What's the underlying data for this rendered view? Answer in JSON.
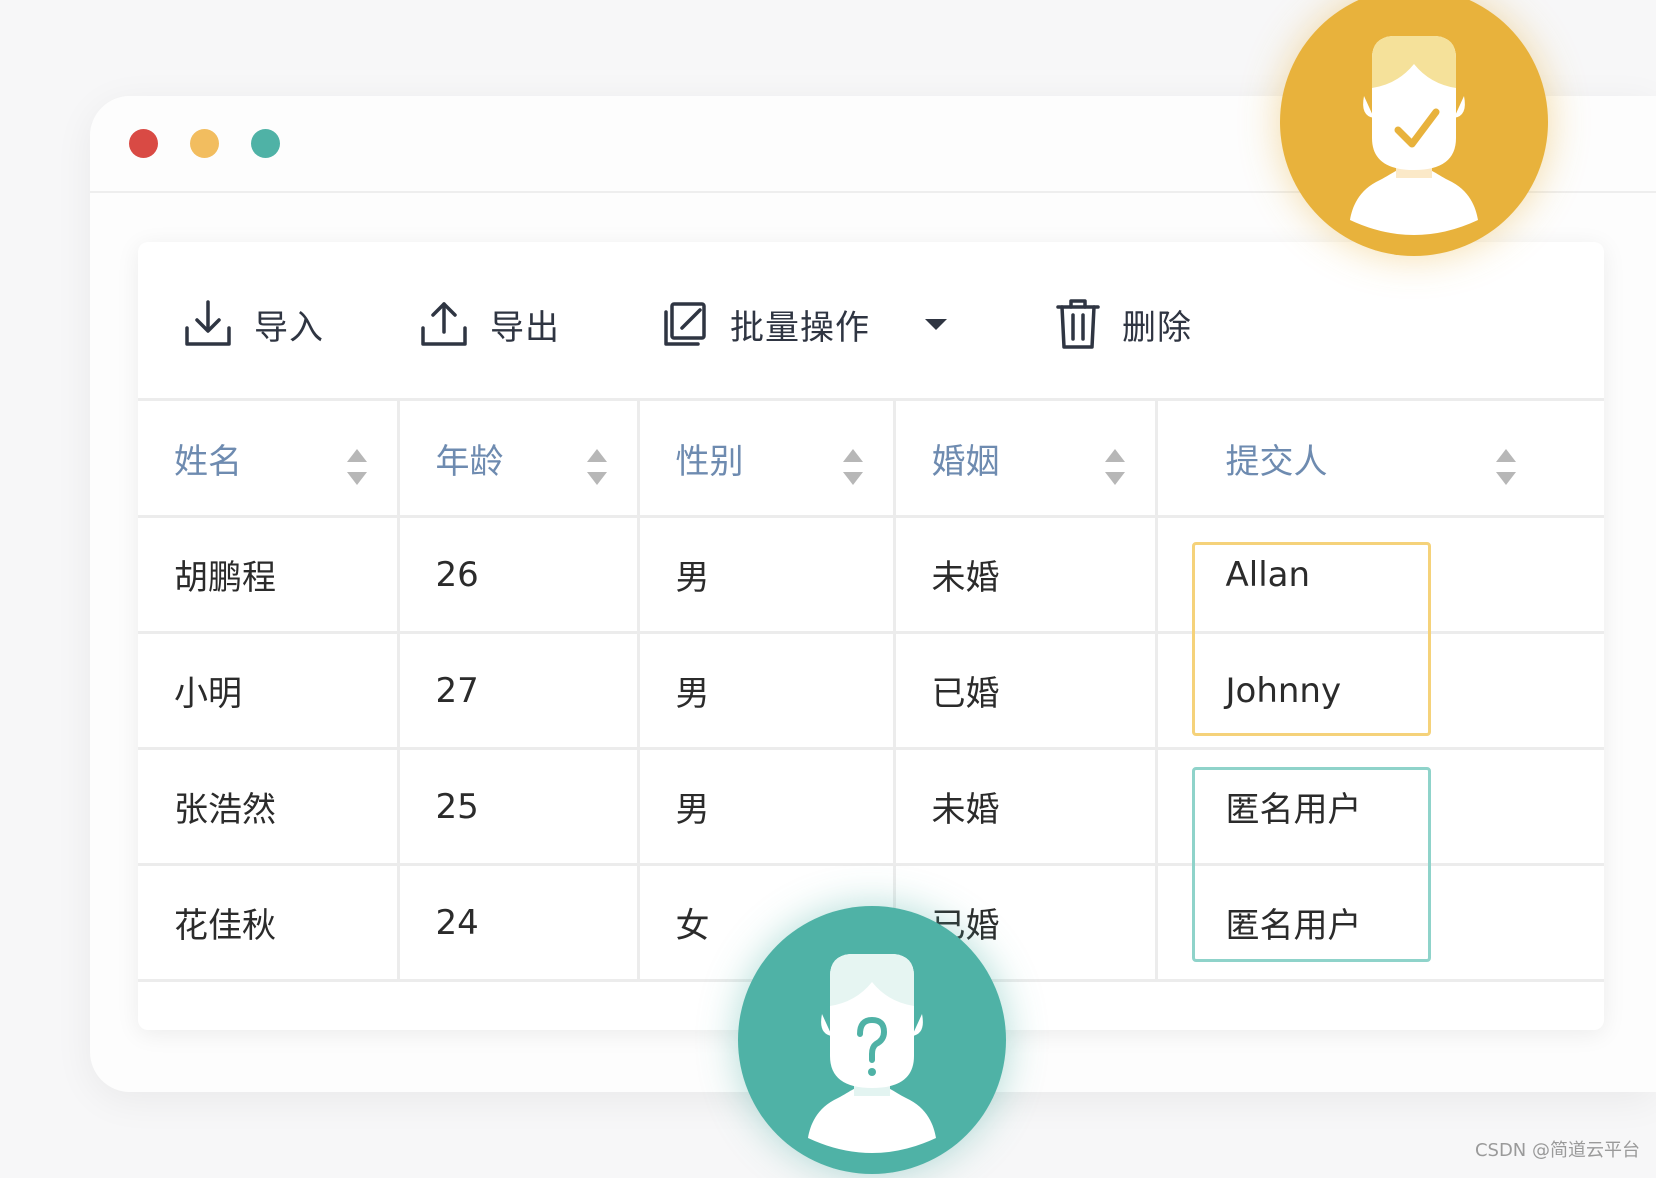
{
  "toolbar": {
    "import_label": "导入",
    "export_label": "导出",
    "batch_label": "批量操作",
    "delete_label": "删除"
  },
  "table": {
    "columns": [
      "姓名",
      "年龄",
      "性别",
      "婚姻",
      "提交人"
    ],
    "rows": [
      [
        "胡鹏程",
        "26",
        "男",
        "未婚",
        "Allan"
      ],
      [
        "小明",
        "27",
        "男",
        "已婚",
        "Johnny"
      ],
      [
        "张浩然",
        "25",
        "男",
        "未婚",
        "匿名用户"
      ],
      [
        "花佳秋",
        "24",
        "女",
        "已婚",
        "匿名用户"
      ]
    ]
  },
  "watermark": "CSDN @简道云平台",
  "colors": {
    "window_dot_red": "#d94a44",
    "window_dot_yellow": "#f2bd5f",
    "window_dot_teal": "#4fb2a6",
    "avatar_gold": "#e8b23c",
    "avatar_teal": "#4fb2a6",
    "header_text": "#6e8bb0"
  },
  "icons": {
    "import": "download-icon",
    "export": "upload-icon",
    "batch": "edit-icon",
    "batch_menu": "caret-down-icon",
    "delete": "trash-icon",
    "sort": "sort-icon",
    "avatar_verified": "check-icon",
    "avatar_anonymous": "question-icon"
  }
}
